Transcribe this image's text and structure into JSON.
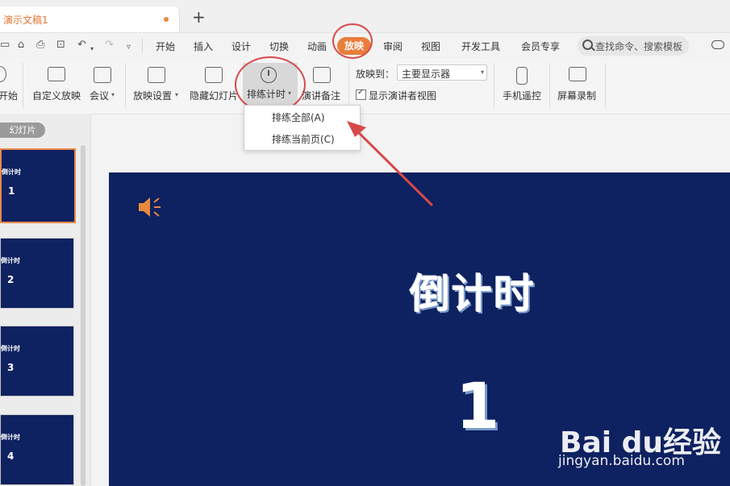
{
  "window": {
    "doc_tab_title": "演示文稿1",
    "new_tab_label": "+"
  },
  "quick_access": {
    "undo_glyph": "↶",
    "redo_glyph": "↷"
  },
  "menu": {
    "items": [
      "开始",
      "插入",
      "设计",
      "切换",
      "动画",
      "放映",
      "审阅",
      "视图",
      "开发工具",
      "会员专享"
    ],
    "active": "放映",
    "search_placeholder": "查找命令、搜索模板"
  },
  "ribbon": {
    "start_label": "开始",
    "custom_show_label": "自定义放映",
    "meeting_label": "会议",
    "show_settings_label": "放映设置",
    "hide_slide_label": "隐藏幻灯片",
    "rehearse_label": "排练计时",
    "speaker_notes_label": "演讲备注",
    "show_on_label": "放映到：",
    "show_on_value": "主要显示器",
    "presenter_view_label": "显示演讲者视图",
    "phone_remote_label": "手机遥控",
    "screen_record_label": "屏幕录制"
  },
  "dropdown": {
    "items": [
      "排练全部(A)",
      "排练当前页(C)"
    ]
  },
  "left_panel": {
    "slides_label": "幻灯片",
    "thumbnails": [
      {
        "title": "倒计时",
        "num": "1",
        "selected": true
      },
      {
        "title": "倒计时",
        "num": "2",
        "selected": false
      },
      {
        "title": "倒计时",
        "num": "3",
        "selected": false
      },
      {
        "title": "倒计时",
        "num": "4",
        "selected": false
      }
    ]
  },
  "slide": {
    "title": "倒计时",
    "number": "1",
    "background": "#0e2160"
  },
  "watermark": {
    "brand": "Bai du经验",
    "url": "jingyan.baidu.com"
  },
  "colors": {
    "accent": "#e97d3a",
    "annotation_red": "#d64a4a",
    "slide_bg": "#0e2160"
  }
}
